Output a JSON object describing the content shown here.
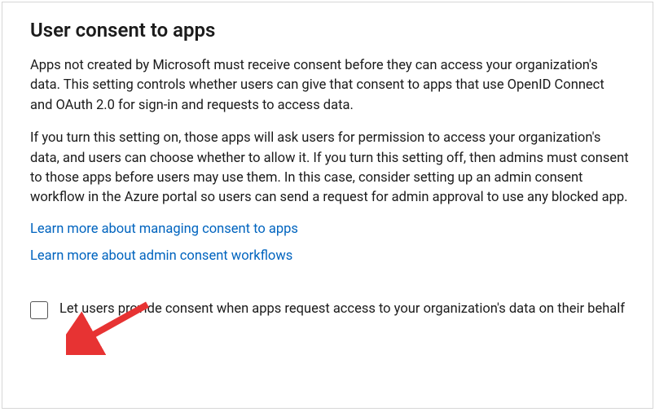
{
  "section": {
    "title": "User consent to apps",
    "paragraph1": "Apps not created by Microsoft must receive consent before they can access your organization's data. This setting controls whether users can give that consent to apps that use OpenID Connect and OAuth 2.0 for sign-in and requests to access data.",
    "paragraph2": "If you turn this setting on, those apps will ask users for permission to access your organization's data, and users can choose whether to allow it. If you turn this setting off, then admins must consent to those apps before users may use them. In this case, consider setting up an admin consent workflow in the Azure portal so users can send a request for admin approval to use any blocked app.",
    "link1": "Learn more about managing consent to apps",
    "link2": "Learn more about admin consent workflows",
    "checkbox_label": "Let users provide consent when apps request access to your organization's data on their behalf"
  },
  "annotation": {
    "arrow_color": "#e73333"
  }
}
